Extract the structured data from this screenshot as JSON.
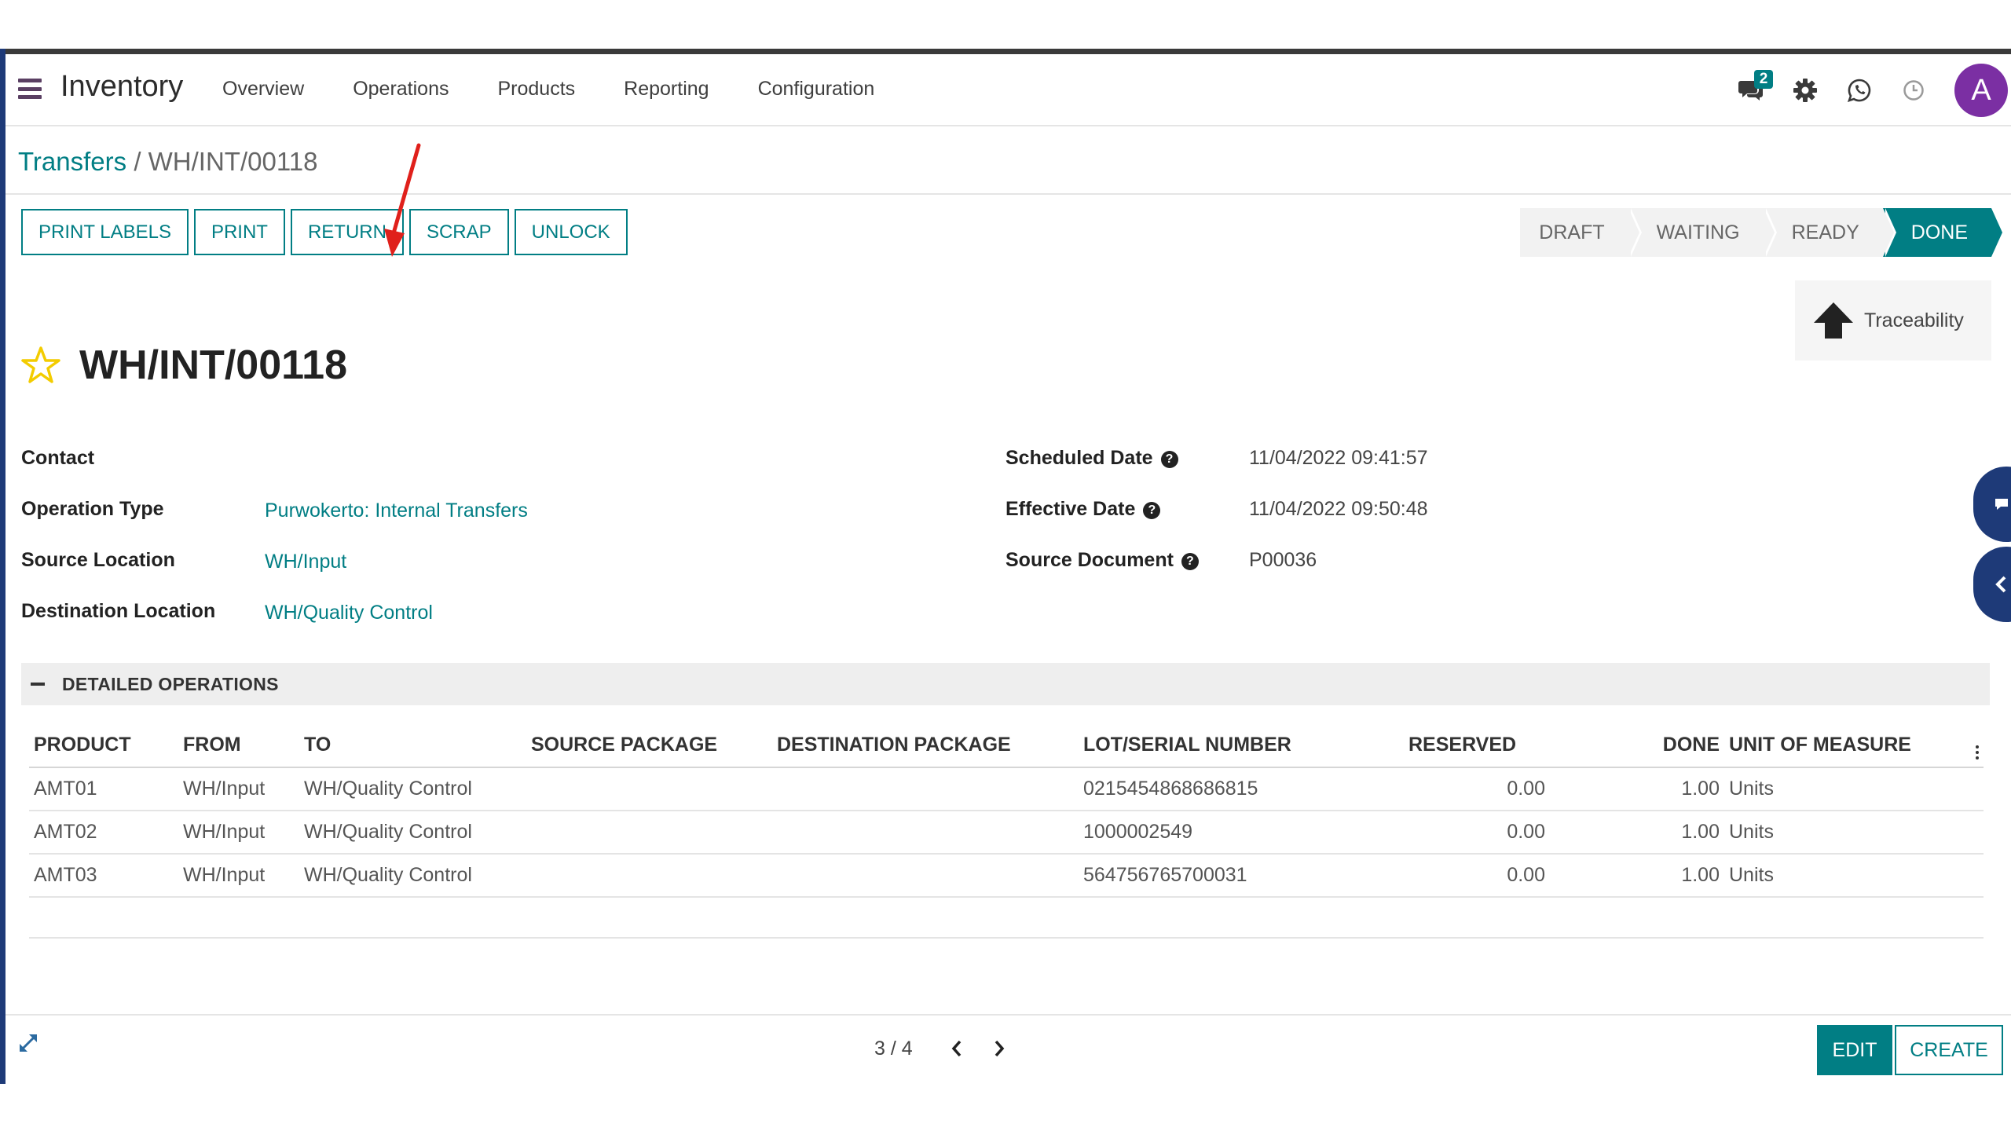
{
  "navbar": {
    "app_name": "Inventory",
    "menu": [
      "Overview",
      "Operations",
      "Products",
      "Reporting",
      "Configuration"
    ],
    "messages_badge": "2",
    "avatar_initial": "A",
    "avatar_color": "#7b2fa3"
  },
  "breadcrumb": {
    "parent": "Transfers",
    "separator": "/",
    "current": "WH/INT/00118"
  },
  "actions": {
    "print_labels": "PRINT LABELS",
    "print": "PRINT",
    "return": "RETURN",
    "scrap": "SCRAP",
    "unlock": "UNLOCK"
  },
  "status": {
    "stages": [
      "DRAFT",
      "WAITING",
      "READY",
      "DONE"
    ],
    "active": "DONE"
  },
  "smart_button": {
    "traceability": "Traceability"
  },
  "record": {
    "title": "WH/INT/00118",
    "contact_label": "Contact",
    "contact_value": "",
    "operation_type_label": "Operation Type",
    "operation_type_value": "Purwokerto: Internal Transfers",
    "source_location_label": "Source Location",
    "source_location_value": "WH/Input",
    "destination_location_label": "Destination Location",
    "destination_location_value": "WH/Quality Control",
    "scheduled_date_label": "Scheduled Date",
    "scheduled_date_value": "11/04/2022 09:41:57",
    "effective_date_label": "Effective Date",
    "effective_date_value": "11/04/2022 09:50:48",
    "source_document_label": "Source Document",
    "source_document_value": "P00036",
    "help_glyph": "?"
  },
  "detailed_operations": {
    "title": "DETAILED OPERATIONS",
    "columns": [
      "PRODUCT",
      "FROM",
      "TO",
      "SOURCE PACKAGE",
      "DESTINATION PACKAGE",
      "LOT/SERIAL NUMBER",
      "RESERVED",
      "DONE",
      "UNIT OF MEASURE"
    ],
    "rows": [
      [
        "AMT01",
        "WH/Input",
        "WH/Quality Control",
        "",
        "",
        "0215454868686815",
        "0.00",
        "1.00",
        "Units"
      ],
      [
        "AMT02",
        "WH/Input",
        "WH/Quality Control",
        "",
        "",
        "1000002549",
        "0.00",
        "1.00",
        "Units"
      ],
      [
        "AMT03",
        "WH/Input",
        "WH/Quality Control",
        "",
        "",
        "564756765700031",
        "0.00",
        "1.00",
        "Units"
      ]
    ]
  },
  "pager": {
    "value": "3 / 4"
  },
  "footer": {
    "edit": "EDIT",
    "create": "CREATE"
  },
  "colors": {
    "primary": "#017e84",
    "annotation_arrow": "#e0201b",
    "side_panel": "#1e3a78"
  },
  "icons": [
    "menu-icon",
    "chat-icon",
    "gear-icon",
    "whatsapp-icon",
    "clock-icon",
    "arrow-up-icon",
    "star-icon",
    "help-icon",
    "chevron-left-icon",
    "chevron-right-icon",
    "expand-icon",
    "kebab-icon"
  ]
}
